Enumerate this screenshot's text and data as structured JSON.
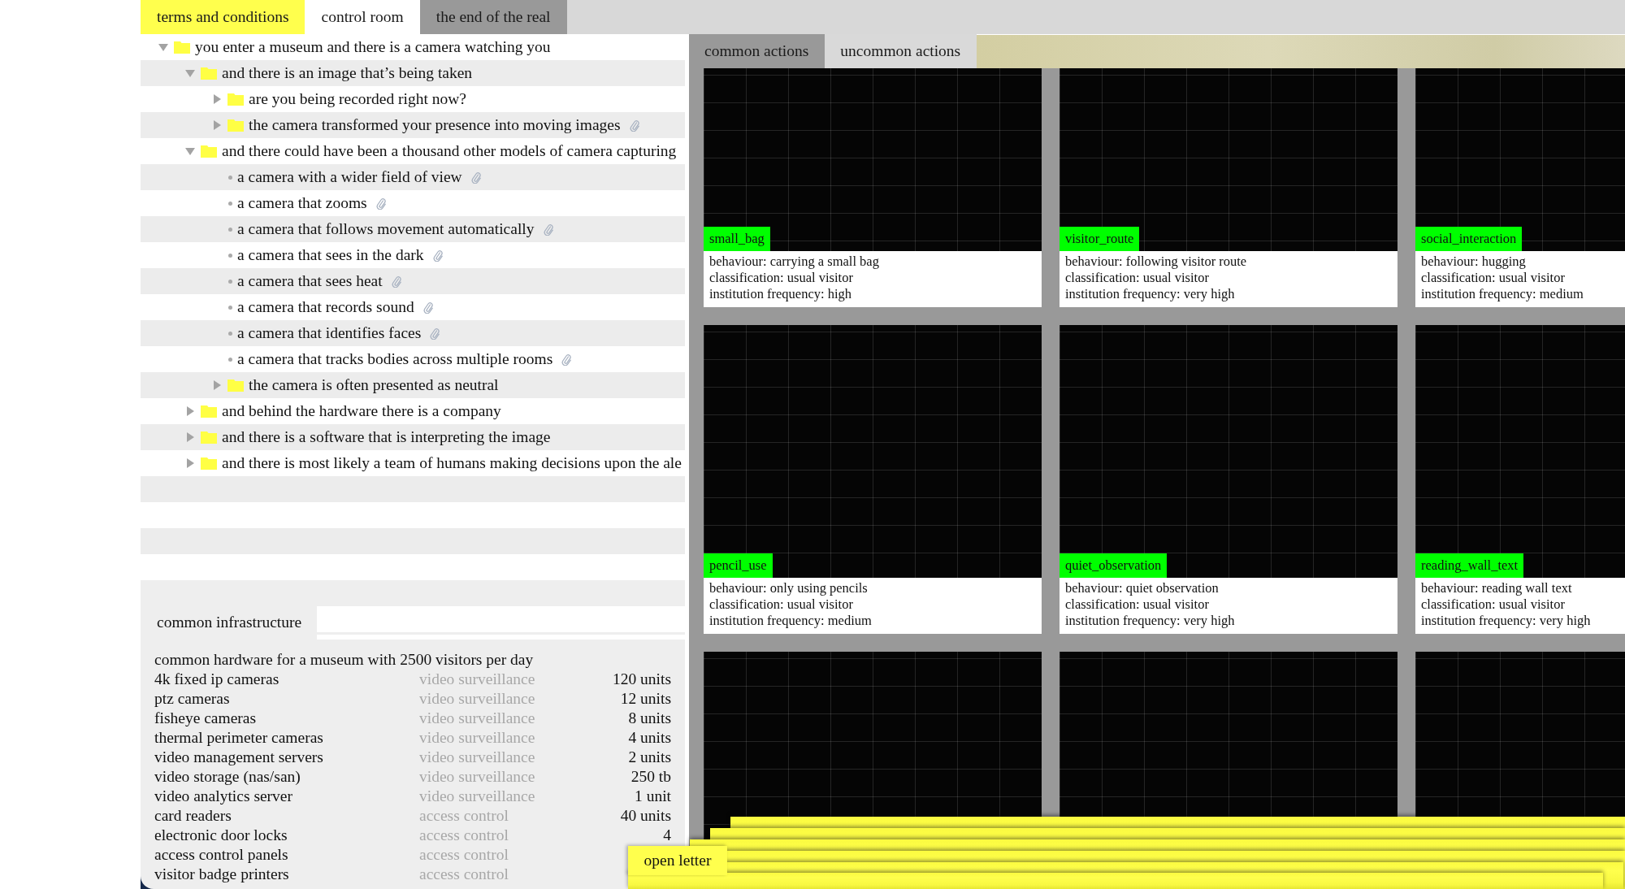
{
  "top_tabs": [
    {
      "label": "terms and conditions",
      "selected": false,
      "color": "#ffff4d"
    },
    {
      "label": "control room",
      "selected": true
    },
    {
      "label": "the end of the real",
      "selected": false,
      "color": "#999999"
    }
  ],
  "tree": [
    {
      "kind": "folder",
      "label": "you enter a museum and there is a camera watching you",
      "expanded": true,
      "attachment": false,
      "children": [
        {
          "kind": "folder",
          "label": "and there is an image that’s being taken",
          "expanded": true,
          "attachment": false,
          "children": [
            {
              "kind": "folder",
              "label": "are you being recorded right now?",
              "expanded": false,
              "attachment": false
            },
            {
              "kind": "folder",
              "label": "the camera transformed your presence into moving images",
              "expanded": false,
              "attachment": true
            }
          ]
        },
        {
          "kind": "folder",
          "label": "and there could have been a thousand other models of camera capturing",
          "expanded": true,
          "attachment": false,
          "children": [
            {
              "kind": "item",
              "label": "a camera with a wider field of view",
              "attachment": true
            },
            {
              "kind": "item",
              "label": "a camera that zooms",
              "attachment": true
            },
            {
              "kind": "item",
              "label": "a camera that follows movement automatically",
              "attachment": true
            },
            {
              "kind": "item",
              "label": "a camera that sees in the dark",
              "attachment": true
            },
            {
              "kind": "item",
              "label": "a camera that sees heat",
              "attachment": true
            },
            {
              "kind": "item",
              "label": "a camera that records sound",
              "attachment": true
            },
            {
              "kind": "item",
              "label": "a camera that identifies faces",
              "attachment": true
            },
            {
              "kind": "item",
              "label": "a camera that tracks bodies across multiple rooms",
              "attachment": true
            },
            {
              "kind": "folder",
              "label": "the camera is often presented as neutral",
              "expanded": false,
              "attachment": false
            }
          ]
        },
        {
          "kind": "folder",
          "label": "and behind the hardware there is a company",
          "expanded": false,
          "attachment": false
        },
        {
          "kind": "folder",
          "label": "and there is a software that is interpreting the image",
          "expanded": false,
          "attachment": false
        },
        {
          "kind": "folder",
          "label": "and there is most likely a team of humans making decisions upon the ale",
          "expanded": false,
          "attachment": false
        }
      ]
    }
  ],
  "infrastructure": {
    "tab": "common infrastructure",
    "heading": "common hardware for a museum with 2500 visitors per day",
    "rows": [
      {
        "item": "4k fixed ip cameras",
        "category": "video surveillance",
        "quantity": "120 units"
      },
      {
        "item": "ptz cameras",
        "category": "video surveillance",
        "quantity": "12 units"
      },
      {
        "item": "fisheye cameras",
        "category": "video surveillance",
        "quantity": "8 units"
      },
      {
        "item": "thermal perimeter cameras",
        "category": "video surveillance",
        "quantity": "4 units"
      },
      {
        "item": "video management servers",
        "category": "video surveillance",
        "quantity": "2 units"
      },
      {
        "item": "video storage (nas/san)",
        "category": "video surveillance",
        "quantity": "250 tb"
      },
      {
        "item": "video analytics server",
        "category": "video surveillance",
        "quantity": "1 unit"
      },
      {
        "item": "card readers",
        "category": "access control",
        "quantity": "40 units"
      },
      {
        "item": "electronic door locks",
        "category": "access control",
        "quantity": "4"
      },
      {
        "item": "access control panels",
        "category": "access control"
      },
      {
        "item": "visitor badge printers",
        "category": "access control"
      }
    ]
  },
  "actions": {
    "tabs": [
      {
        "label": "common actions",
        "selected": true
      },
      {
        "label": "uncommon actions",
        "selected": false
      }
    ],
    "cards": [
      {
        "kind": "captioned",
        "tag": "small_bag",
        "lines": [
          "behaviour: carrying a small bag",
          "classification: usual visitor",
          "institution frequency: high"
        ]
      },
      {
        "kind": "captioned",
        "tag": "visitor_route",
        "lines": [
          "behaviour: following visitor route",
          "classification: usual visitor",
          "institution frequency: very high"
        ]
      },
      {
        "kind": "captioned",
        "tag": "social_interaction",
        "lines": [
          "behaviour: hugging",
          "classification: usual visitor",
          "institution frequency: medium"
        ]
      },
      {
        "kind": "captioned",
        "tag": "pencil_use",
        "lines": [
          "behaviour: only using pencils",
          "classification: usual visitor",
          "institution frequency: medium"
        ]
      },
      {
        "kind": "captioned",
        "tag": "quiet_observation",
        "lines": [
          "behaviour: quiet observation",
          "classification: usual visitor",
          "institution frequency: very high"
        ]
      },
      {
        "kind": "captioned",
        "tag": "reading_wall_text",
        "lines": [
          "behaviour: reading wall text",
          "classification: usual visitor",
          "institution frequency: very high"
        ]
      },
      {
        "kind": "frame"
      },
      {
        "kind": "frame"
      },
      {
        "kind": "frame"
      }
    ]
  },
  "letters": {
    "tab": "open letter"
  }
}
